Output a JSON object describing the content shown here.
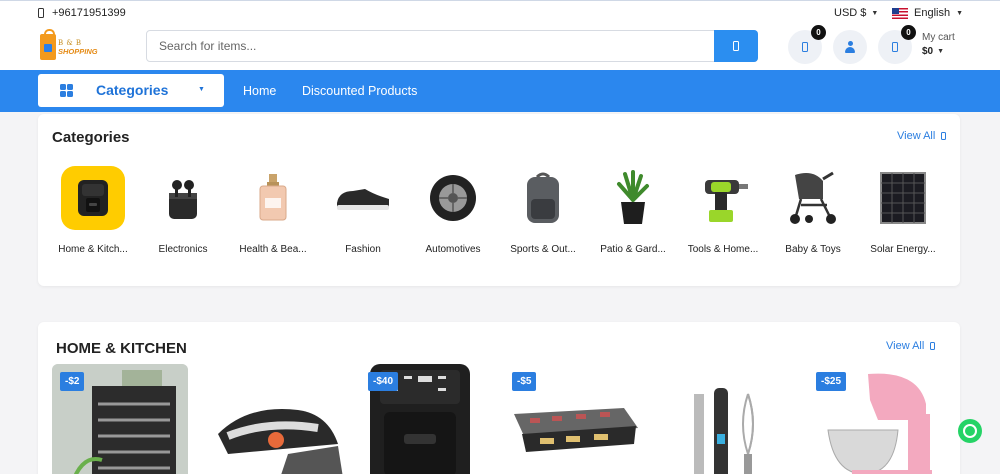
{
  "topbar": {
    "phone": "+96171951399",
    "currency": "USD $",
    "language": "English"
  },
  "header": {
    "logo_line1": "B & B",
    "logo_line2": "SHOPPING",
    "search_placeholder": "Search for items...",
    "wishlist_count": "0",
    "cart_count": "0",
    "cart_label": "My cart",
    "cart_total": "$0"
  },
  "nav": {
    "categories_label": "Categories",
    "links": [
      "Home",
      "Discounted Products"
    ]
  },
  "categories_section": {
    "title": "Categories",
    "view_all": "View All",
    "items": [
      "Home & Kitch...",
      "Electronics",
      "Health & Bea...",
      "Fashion",
      "Automotives",
      "Sports & Out...",
      "Patio & Gard...",
      "Tools & Home...",
      "Baby & Toys",
      "Solar Energy..."
    ]
  },
  "home_kitchen_section": {
    "title": "HOME & KITCHEN",
    "view_all": "View All",
    "products": [
      {
        "discount": "-$2",
        "icon": "dish-rack-image"
      },
      {
        "discount": "",
        "icon": "steam-iron-image"
      },
      {
        "discount": "-$40",
        "icon": "air-fryer-image"
      },
      {
        "discount": "-$5",
        "icon": "raclette-grill-image"
      },
      {
        "discount": "",
        "icon": "hand-blender-image"
      },
      {
        "discount": "-$25",
        "icon": "stand-mixer-image"
      }
    ]
  },
  "colors": {
    "primary": "#2b87ee",
    "accent": "#ffcc00",
    "whatsapp": "#25d366"
  }
}
